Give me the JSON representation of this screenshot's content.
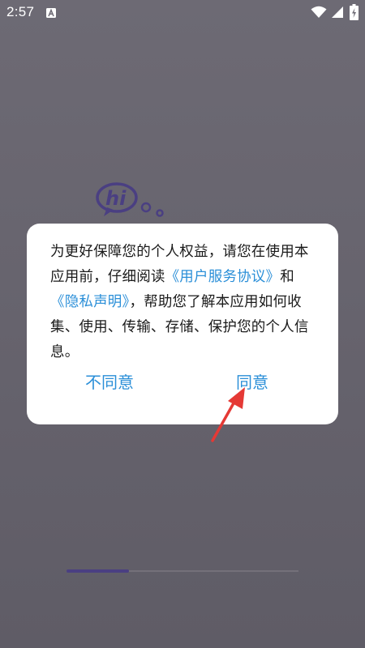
{
  "status_bar": {
    "time": "2:57"
  },
  "dialog": {
    "text_before_service": "为更好保障您的个人权益，请您在使用本应用前，仔细阅读",
    "service_link": "《用户服务协议》",
    "text_and": "和",
    "privacy_link": "《隐私声明》",
    "text_after_privacy": "，帮助您了解本应用如何收集、使用、传输、存储、保护您的个人信息。",
    "disagree_label": "不同意",
    "agree_label": "同意"
  },
  "logo": {
    "text": "hi"
  },
  "colors": {
    "background": "#67646e",
    "dialog_bg": "#ffffff",
    "link": "#2b8fd8",
    "body_text": "#1a1a1a",
    "logo": "#4a3f82",
    "arrow": "#e53935",
    "indicator_active": "#4a3f82"
  },
  "icons": {
    "notification": "a-notification-icon",
    "wifi": "wifi-icon",
    "signal": "signal-icon",
    "battery": "battery-charging-icon"
  },
  "page_indicator": {
    "active_fraction": 0.27
  }
}
